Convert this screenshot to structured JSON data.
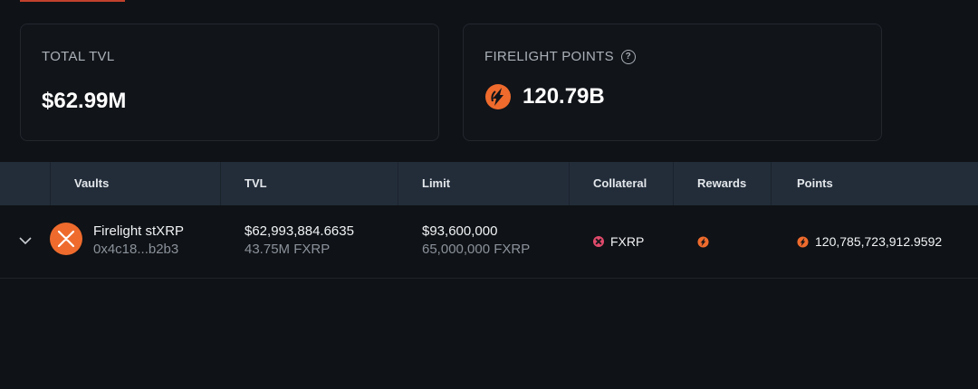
{
  "summary": {
    "tvl": {
      "label": "TOTAL TVL",
      "value": "$62.99M"
    },
    "points": {
      "label": "FIRELIGHT POINTS",
      "value": "120.79B",
      "help_icon": "question-circle-icon"
    }
  },
  "table": {
    "headers": {
      "vaults": "Vaults",
      "tvl": "TVL",
      "limit": "Limit",
      "collateral": "Collateral",
      "rewards": "Rewards",
      "points": "Points"
    },
    "rows": [
      {
        "name": "Firelight stXRP",
        "address": "0x4c18...b2b3",
        "tvl_usd": "$62,993,884.6635",
        "tvl_token": "43.75M FXRP",
        "limit_usd": "$93,600,000",
        "limit_token": "65,000,000 FXRP",
        "collateral": "FXRP",
        "rewards_icon": "firelight-icon",
        "points": "120,785,723,912.9592"
      }
    ]
  },
  "colors": {
    "background": "#0f1216",
    "card_border": "#23272e",
    "header_bg": "#232d3a",
    "accent": "#ee6b2d",
    "collateral_icon": "#e04a6b"
  }
}
